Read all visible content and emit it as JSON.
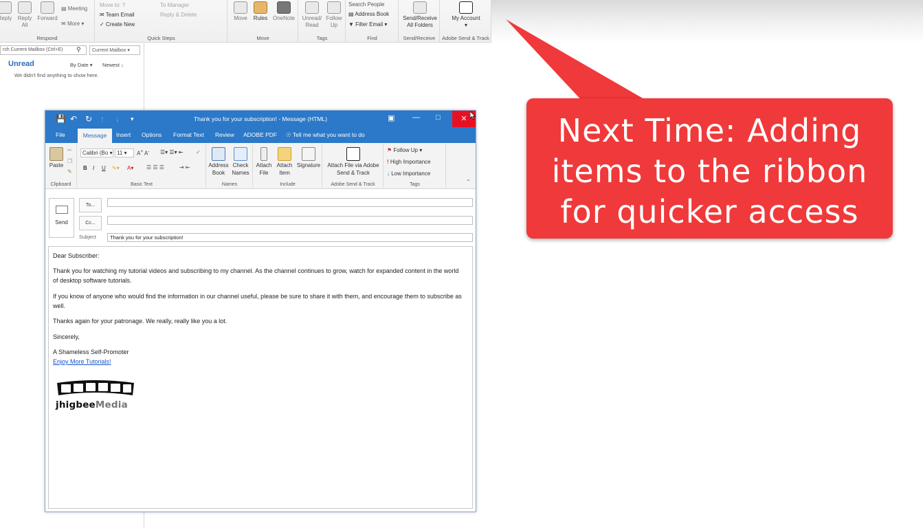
{
  "bg_ribbon": {
    "respond": {
      "reply": "Reply",
      "reply_all": "Reply All",
      "forward": "Forward",
      "meeting": "Meeting",
      "more": "More",
      "label": "Respond"
    },
    "quick_steps": {
      "items": [
        "Move to: ?",
        "Team Email",
        "Create New"
      ],
      "items_right": [
        "To Manager",
        "Reply & Delete"
      ],
      "label": "Quick Steps"
    },
    "move": {
      "move": "Move",
      "rules": "Rules",
      "onenote": "OneNote",
      "label": "Move"
    },
    "tags": {
      "unread_read": "Unread/ Read",
      "follow_up": "Follow Up",
      "label": "Tags"
    },
    "find": {
      "search_people": "Search People",
      "address_book": "Address Book",
      "filter_email": "Filter Email",
      "label": "Find"
    },
    "send_receive": {
      "button": "Send/Receive All Folders",
      "label": "Send/Receive"
    },
    "adobe": {
      "my_account": "My Account",
      "label": "Adobe Send & Track"
    }
  },
  "mail_list": {
    "search_placeholder": "rch Current Mailbox (Ctrl+E)",
    "scope": "Current Mailbox",
    "filter": "Unread",
    "sort_by": "By Date",
    "sort_order": "Newest",
    "empty_text": "We didn't find anything to show here."
  },
  "callout": {
    "line1": "Next Time: Adding",
    "line2": "items to the ribbon",
    "line3": "for quicker access",
    "color": "#f0393a"
  },
  "message_window": {
    "title": "Thank you for your subscription! - Message (HTML)",
    "tabs": [
      "File",
      "Message",
      "Insert",
      "Options",
      "Format Text",
      "Review",
      "ADOBE PDF"
    ],
    "tell_me": "Tell me what you want to do",
    "ribbon": {
      "paste": "Paste",
      "clipboard_label": "Clipboard",
      "font_name": "Calibri (Bo",
      "font_size": "11",
      "basic_text_label": "Basic Text",
      "address_book": "Address Book",
      "check_names": "Check Names",
      "names_label": "Names",
      "attach_file": "Attach File",
      "attach_item": "Attach Item",
      "signature": "Signature",
      "include_label": "Include",
      "attach_via_adobe": "Attach File via Adobe Send & Track",
      "adobe_label": "Adobe Send & Track",
      "follow_up": "Follow Up",
      "high_importance": "High Importance",
      "low_importance": "Low Importance",
      "tags_label": "Tags"
    },
    "send": "Send",
    "to_label": "To...",
    "cc_label": "Cc...",
    "subject_label": "Subject",
    "subject_value": "Thank you for your subscription!",
    "body": {
      "greeting": "Dear Subscriber:",
      "p1": "Thank you for watching my tutorial videos and subscribing to my channel. As the channel continues to grow, watch for expanded content in the world of desktop software tutorials.",
      "p2": "If you know of anyone who would find the information in our channel useful, please be sure to share it with them, and encourage them to subscribe as well.",
      "p3": "Thanks again for your patronage. We really, really like you a lot.",
      "closing": "Sincerely,",
      "signature_name": "A Shameless Self-Promoter",
      "link": "Enjoy More Tutorials!",
      "logo_part1": "jhigbee",
      "logo_part2": "Media"
    }
  }
}
